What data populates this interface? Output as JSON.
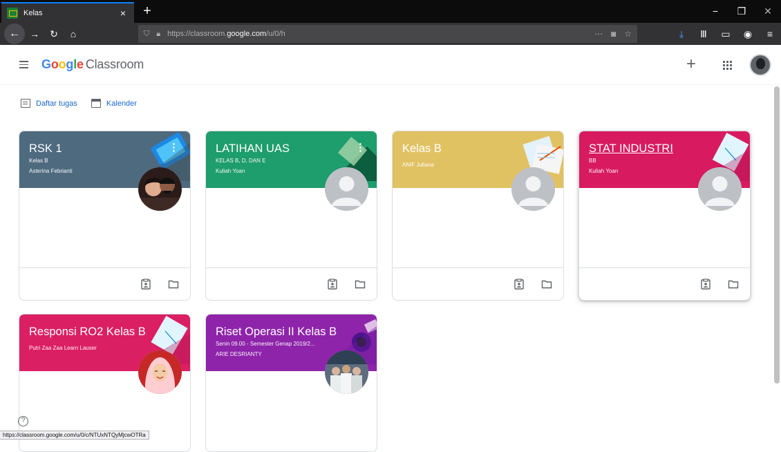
{
  "browser": {
    "tab_title": "Kelas",
    "tab_close": "×",
    "newtab": "+",
    "url_prefix": "https://classroom.",
    "url_domain": "google.com",
    "url_suffix": "/u/0/h",
    "win_min": "−",
    "win_max": "❐",
    "win_close": "✕"
  },
  "app": {
    "logo_google": [
      "G",
      "o",
      "o",
      "g",
      "l",
      "e"
    ],
    "logo_classroom": "Classroom"
  },
  "subnav": {
    "todo": "Daftar tugas",
    "calendar": "Kalender"
  },
  "cards": [
    {
      "title": "RSK 1",
      "section": "Kelas B",
      "teacher": "Asterina Febrianti",
      "color": "#4e6a7f",
      "avatar": "photo-couple",
      "underline": false,
      "kebab": true
    },
    {
      "title": "LATIHAN UAS",
      "section": "KELAS B, D, DAN E",
      "teacher": "Kuliah Yoan",
      "color": "#1e9d6d",
      "avatar": "default",
      "underline": false,
      "kebab": true
    },
    {
      "title": "Kelas B",
      "section": "",
      "teacher": "ANIF Juliana",
      "color": "#e1c263",
      "avatar": "default",
      "underline": false,
      "kebab": false
    },
    {
      "title": "STAT INDUSTRI",
      "section": "BB",
      "teacher": "Kuliah Yoan",
      "color": "#d81b60",
      "avatar": "default",
      "underline": true,
      "kebab": false
    },
    {
      "title": "Responsi RO2 Kelas B",
      "section": "",
      "teacher": "Putri Zaa Zaa Learn Lauser",
      "color": "#db1f63",
      "avatar": "photo-hijab",
      "underline": false,
      "kebab": false
    },
    {
      "title": "Riset Operasi II Kelas B",
      "section": "Senin 09.00 - Semester Genap 2019/2...",
      "teacher": "ARIE DESRIANTY",
      "color": "#8e24aa",
      "avatar": "photo-group",
      "underline": false,
      "kebab": false
    }
  ],
  "status_url": "https://classroom.google.com/u/0/c/NTUxNTQyMjcwOTRa",
  "help": "?"
}
